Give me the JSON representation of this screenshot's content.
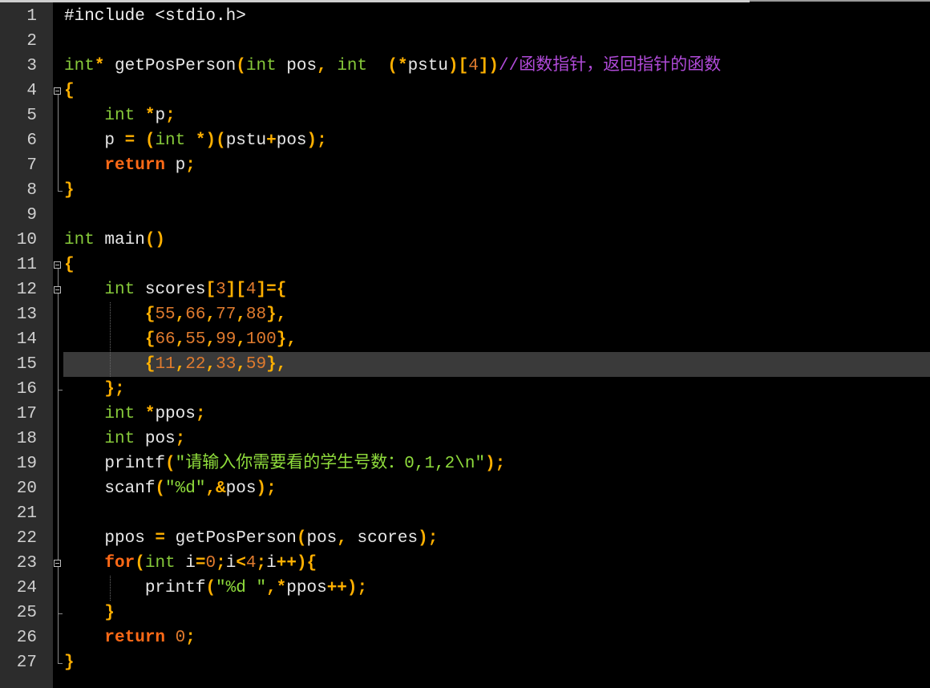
{
  "editor": {
    "current_line": 15,
    "lines": [
      {
        "n": "1",
        "segments": [
          {
            "t": "#include <stdio.h>",
            "c": "p"
          }
        ]
      },
      {
        "n": "2",
        "segments": []
      },
      {
        "n": "3",
        "segments": [
          {
            "t": "int",
            "c": "k"
          },
          {
            "t": "*",
            "c": "o"
          },
          {
            "t": " getPosPerson",
            "c": ""
          },
          {
            "t": "(",
            "c": "o"
          },
          {
            "t": "int",
            "c": "k"
          },
          {
            "t": " pos",
            "c": ""
          },
          {
            "t": ",",
            "c": "o"
          },
          {
            "t": " ",
            "c": ""
          },
          {
            "t": "int",
            "c": "k"
          },
          {
            "t": "  ",
            "c": ""
          },
          {
            "t": "(*",
            "c": "o"
          },
          {
            "t": "pstu",
            "c": ""
          },
          {
            "t": ")[",
            "c": "o"
          },
          {
            "t": "4",
            "c": "n"
          },
          {
            "t": "])",
            "c": "o"
          },
          {
            "t": "//函数指针，返回指针的函数",
            "c": "c"
          }
        ]
      },
      {
        "n": "4",
        "segments": [
          {
            "t": "{",
            "c": "o"
          }
        ]
      },
      {
        "n": "5",
        "segments": [
          {
            "t": "    ",
            "c": ""
          },
          {
            "t": "int",
            "c": "k"
          },
          {
            "t": " ",
            "c": ""
          },
          {
            "t": "*",
            "c": "o"
          },
          {
            "t": "p",
            "c": ""
          },
          {
            "t": ";",
            "c": "o"
          }
        ]
      },
      {
        "n": "6",
        "segments": [
          {
            "t": "    p ",
            "c": ""
          },
          {
            "t": "=",
            "c": "o"
          },
          {
            "t": " ",
            "c": ""
          },
          {
            "t": "(",
            "c": "o"
          },
          {
            "t": "int",
            "c": "k"
          },
          {
            "t": " ",
            "c": ""
          },
          {
            "t": "*)(",
            "c": "o"
          },
          {
            "t": "pstu",
            "c": ""
          },
          {
            "t": "+",
            "c": "o"
          },
          {
            "t": "pos",
            "c": ""
          },
          {
            "t": ");",
            "c": "o"
          }
        ]
      },
      {
        "n": "7",
        "segments": [
          {
            "t": "    ",
            "c": ""
          },
          {
            "t": "return",
            "c": "r"
          },
          {
            "t": " p",
            "c": ""
          },
          {
            "t": ";",
            "c": "o"
          }
        ]
      },
      {
        "n": "8",
        "segments": [
          {
            "t": "}",
            "c": "o"
          }
        ]
      },
      {
        "n": "9",
        "segments": []
      },
      {
        "n": "10",
        "segments": [
          {
            "t": "int",
            "c": "k"
          },
          {
            "t": " main",
            "c": ""
          },
          {
            "t": "()",
            "c": "o"
          }
        ]
      },
      {
        "n": "11",
        "segments": [
          {
            "t": "{",
            "c": "o"
          }
        ]
      },
      {
        "n": "12",
        "segments": [
          {
            "t": "    ",
            "c": ""
          },
          {
            "t": "int",
            "c": "k"
          },
          {
            "t": " scores",
            "c": ""
          },
          {
            "t": "[",
            "c": "o"
          },
          {
            "t": "3",
            "c": "n"
          },
          {
            "t": "][",
            "c": "o"
          },
          {
            "t": "4",
            "c": "n"
          },
          {
            "t": "]={",
            "c": "o"
          }
        ]
      },
      {
        "n": "13",
        "segments": [
          {
            "t": "        ",
            "c": ""
          },
          {
            "t": "{",
            "c": "o"
          },
          {
            "t": "55",
            "c": "n"
          },
          {
            "t": ",",
            "c": "o"
          },
          {
            "t": "66",
            "c": "n"
          },
          {
            "t": ",",
            "c": "o"
          },
          {
            "t": "77",
            "c": "n"
          },
          {
            "t": ",",
            "c": "o"
          },
          {
            "t": "88",
            "c": "n"
          },
          {
            "t": "},",
            "c": "o"
          }
        ]
      },
      {
        "n": "14",
        "segments": [
          {
            "t": "        ",
            "c": ""
          },
          {
            "t": "{",
            "c": "o"
          },
          {
            "t": "66",
            "c": "n"
          },
          {
            "t": ",",
            "c": "o"
          },
          {
            "t": "55",
            "c": "n"
          },
          {
            "t": ",",
            "c": "o"
          },
          {
            "t": "99",
            "c": "n"
          },
          {
            "t": ",",
            "c": "o"
          },
          {
            "t": "100",
            "c": "n"
          },
          {
            "t": "},",
            "c": "o"
          }
        ]
      },
      {
        "n": "15",
        "segments": [
          {
            "t": "        ",
            "c": ""
          },
          {
            "t": "{",
            "c": "o"
          },
          {
            "t": "11",
            "c": "n"
          },
          {
            "t": ",",
            "c": "o"
          },
          {
            "t": "22",
            "c": "n"
          },
          {
            "t": ",",
            "c": "o"
          },
          {
            "t": "33",
            "c": "n"
          },
          {
            "t": ",",
            "c": "o"
          },
          {
            "t": "59",
            "c": "n"
          },
          {
            "t": "},",
            "c": "o"
          }
        ]
      },
      {
        "n": "16",
        "segments": [
          {
            "t": "    ",
            "c": ""
          },
          {
            "t": "};",
            "c": "o"
          }
        ]
      },
      {
        "n": "17",
        "segments": [
          {
            "t": "    ",
            "c": ""
          },
          {
            "t": "int",
            "c": "k"
          },
          {
            "t": " ",
            "c": ""
          },
          {
            "t": "*",
            "c": "o"
          },
          {
            "t": "ppos",
            "c": ""
          },
          {
            "t": ";",
            "c": "o"
          }
        ]
      },
      {
        "n": "18",
        "segments": [
          {
            "t": "    ",
            "c": ""
          },
          {
            "t": "int",
            "c": "k"
          },
          {
            "t": " pos",
            "c": ""
          },
          {
            "t": ";",
            "c": "o"
          }
        ]
      },
      {
        "n": "19",
        "segments": [
          {
            "t": "    printf",
            "c": ""
          },
          {
            "t": "(",
            "c": "o"
          },
          {
            "t": "\"请输入你需要看的学生号数：0,1,2\\n\"",
            "c": "s"
          },
          {
            "t": ");",
            "c": "o"
          }
        ]
      },
      {
        "n": "20",
        "segments": [
          {
            "t": "    scanf",
            "c": ""
          },
          {
            "t": "(",
            "c": "o"
          },
          {
            "t": "\"%d\"",
            "c": "s"
          },
          {
            "t": ",&",
            "c": "o"
          },
          {
            "t": "pos",
            "c": ""
          },
          {
            "t": ");",
            "c": "o"
          }
        ]
      },
      {
        "n": "21",
        "segments": []
      },
      {
        "n": "22",
        "segments": [
          {
            "t": "    ppos ",
            "c": ""
          },
          {
            "t": "=",
            "c": "o"
          },
          {
            "t": " getPosPerson",
            "c": ""
          },
          {
            "t": "(",
            "c": "o"
          },
          {
            "t": "pos",
            "c": ""
          },
          {
            "t": ",",
            "c": "o"
          },
          {
            "t": " scores",
            "c": ""
          },
          {
            "t": ");",
            "c": "o"
          }
        ]
      },
      {
        "n": "23",
        "segments": [
          {
            "t": "    ",
            "c": ""
          },
          {
            "t": "for",
            "c": "r"
          },
          {
            "t": "(",
            "c": "o"
          },
          {
            "t": "int",
            "c": "k"
          },
          {
            "t": " i",
            "c": ""
          },
          {
            "t": "=",
            "c": "o"
          },
          {
            "t": "0",
            "c": "n"
          },
          {
            "t": ";",
            "c": "o"
          },
          {
            "t": "i",
            "c": ""
          },
          {
            "t": "<",
            "c": "o"
          },
          {
            "t": "4",
            "c": "n"
          },
          {
            "t": ";",
            "c": "o"
          },
          {
            "t": "i",
            "c": ""
          },
          {
            "t": "++){",
            "c": "o"
          }
        ]
      },
      {
        "n": "24",
        "segments": [
          {
            "t": "        printf",
            "c": ""
          },
          {
            "t": "(",
            "c": "o"
          },
          {
            "t": "\"%d \"",
            "c": "s"
          },
          {
            "t": ",*",
            "c": "o"
          },
          {
            "t": "ppos",
            "c": ""
          },
          {
            "t": "++);",
            "c": "o"
          }
        ]
      },
      {
        "n": "25",
        "segments": [
          {
            "t": "    ",
            "c": ""
          },
          {
            "t": "}",
            "c": "o"
          }
        ]
      },
      {
        "n": "26",
        "segments": [
          {
            "t": "    ",
            "c": ""
          },
          {
            "t": "return",
            "c": "r"
          },
          {
            "t": " ",
            "c": ""
          },
          {
            "t": "0",
            "c": "n"
          },
          {
            "t": ";",
            "c": "o"
          }
        ]
      },
      {
        "n": "27",
        "segments": [
          {
            "t": "}",
            "c": "o"
          }
        ]
      }
    ]
  }
}
